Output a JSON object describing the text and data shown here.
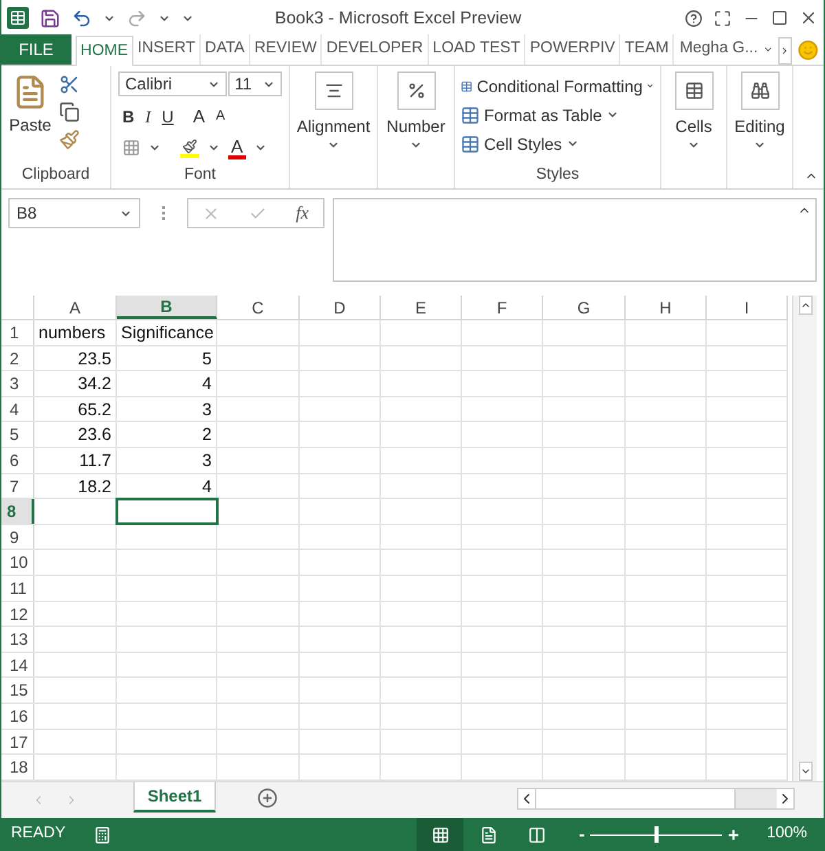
{
  "window": {
    "title": "Book3 - Microsoft Excel Preview"
  },
  "file_tab": {
    "label": "FILE"
  },
  "tabs": [
    {
      "label": "HOME",
      "selected": true
    },
    {
      "label": "INSERT",
      "selected": false
    },
    {
      "label": "DATA",
      "selected": false
    },
    {
      "label": "REVIEW",
      "selected": false
    },
    {
      "label": "DEVELOPER",
      "selected": false
    },
    {
      "label": "LOAD TEST",
      "selected": false
    },
    {
      "label": "POWERPIV",
      "selected": false
    },
    {
      "label": "TEAM",
      "selected": false
    }
  ],
  "user": {
    "name": "Megha G..."
  },
  "ribbon": {
    "clipboard": {
      "paste": "Paste",
      "label": "Clipboard"
    },
    "font": {
      "name": "Calibri",
      "size": "11",
      "bold": "B",
      "italic": "I",
      "underline": "U",
      "grow": "A",
      "shrink": "A",
      "font_color": "A",
      "label": "Font"
    },
    "alignment": {
      "label": "Alignment"
    },
    "number": {
      "label": "Number"
    },
    "styles": {
      "items": [
        "Conditional Formatting",
        "Format as Table",
        "Cell Styles"
      ],
      "label": "Styles"
    },
    "cells": {
      "label": "Cells"
    },
    "editing": {
      "label": "Editing"
    }
  },
  "name_box": {
    "value": "B8"
  },
  "formula_bar": {
    "function_button": "fx"
  },
  "columns": [
    {
      "label": "A",
      "selected": false
    },
    {
      "label": "B",
      "selected": true
    },
    {
      "label": "C",
      "selected": false
    },
    {
      "label": "D",
      "selected": false
    },
    {
      "label": "E",
      "selected": false
    },
    {
      "label": "F",
      "selected": false
    },
    {
      "label": "G",
      "selected": false
    },
    {
      "label": "H",
      "selected": false
    },
    {
      "label": "I",
      "selected": false
    }
  ],
  "rows": [
    {
      "number": "1",
      "selected": false,
      "cells": [
        {
          "text": "numbers",
          "kind": "text"
        },
        {
          "text": "Significance",
          "kind": "text"
        }
      ]
    },
    {
      "number": "2",
      "selected": false,
      "cells": [
        {
          "text": "23.5",
          "kind": "number"
        },
        {
          "text": "5",
          "kind": "number"
        }
      ]
    },
    {
      "number": "3",
      "selected": false,
      "cells": [
        {
          "text": "34.2",
          "kind": "number"
        },
        {
          "text": "4",
          "kind": "number"
        }
      ]
    },
    {
      "number": "4",
      "selected": false,
      "cells": [
        {
          "text": "65.2",
          "kind": "number"
        },
        {
          "text": "3",
          "kind": "number"
        }
      ]
    },
    {
      "number": "5",
      "selected": false,
      "cells": [
        {
          "text": "23.6",
          "kind": "number"
        },
        {
          "text": "2",
          "kind": "number"
        }
      ]
    },
    {
      "number": "6",
      "selected": false,
      "cells": [
        {
          "text": "11.7",
          "kind": "number"
        },
        {
          "text": "3",
          "kind": "number"
        }
      ]
    },
    {
      "number": "7",
      "selected": false,
      "cells": [
        {
          "text": "18.2",
          "kind": "number"
        },
        {
          "text": "4",
          "kind": "number"
        }
      ]
    },
    {
      "number": "8",
      "selected": true
    },
    {
      "number": "9",
      "selected": false
    },
    {
      "number": "10",
      "selected": false
    },
    {
      "number": "11",
      "selected": false
    },
    {
      "number": "12",
      "selected": false
    },
    {
      "number": "13",
      "selected": false
    },
    {
      "number": "14",
      "selected": false
    },
    {
      "number": "15",
      "selected": false
    },
    {
      "number": "16",
      "selected": false
    },
    {
      "number": "17",
      "selected": false
    },
    {
      "number": "18",
      "selected": false
    }
  ],
  "sheets": [
    {
      "label": "Sheet1",
      "selected": true
    }
  ],
  "status_bar": {
    "status": "READY",
    "zoom": {
      "level": 0.5,
      "minus": "-",
      "plus": "+",
      "reading": "100%"
    }
  }
}
